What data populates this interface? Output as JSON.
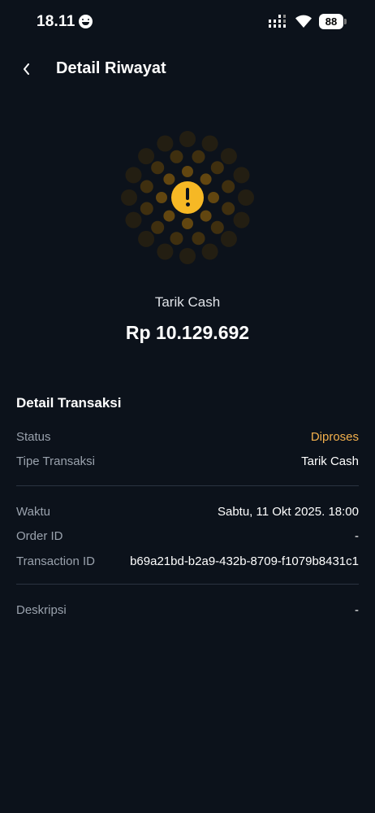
{
  "status_bar": {
    "time": "18.11",
    "battery": "88",
    "icons": [
      "emoji-icon",
      "signal-icon",
      "wifi-icon",
      "battery-icon"
    ]
  },
  "header": {
    "back_icon": "chevron-left-icon",
    "title": "Detail Riwayat"
  },
  "summary": {
    "status_icon": "warning-icon",
    "type": "Tarik Cash",
    "amount": "Rp 10.129.692"
  },
  "details": {
    "title": "Detail Transaksi",
    "groups": [
      {
        "rows": [
          {
            "label": "Status",
            "value": "Diproses"
          },
          {
            "label": "Tipe Transaksi",
            "value": "Tarik Cash"
          }
        ]
      },
      {
        "rows": [
          {
            "label": "Waktu",
            "value": "Sabtu, 11 Okt 2025. 18:00"
          },
          {
            "label": "Order ID",
            "value": "-"
          },
          {
            "label": "Transaction ID",
            "value": "b69a21bd-b2a9-432b-8709-f1079b8431c1"
          }
        ]
      },
      {
        "rows": [
          {
            "label": "Deskripsi",
            "value": "-"
          }
        ]
      }
    ]
  },
  "colors": {
    "background": "#0c121b",
    "accent_warning": "#f6b825",
    "status_pending": "#f3b04c",
    "label_text": "#9aa2ad",
    "divider": "#2b3441"
  }
}
